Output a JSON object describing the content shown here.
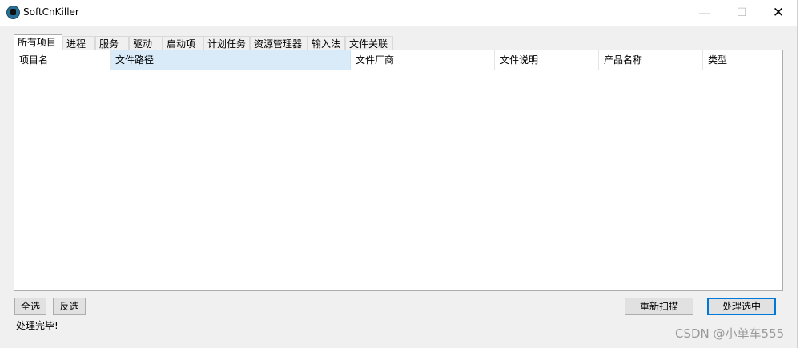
{
  "window": {
    "title": "SoftCnKiller"
  },
  "titlebar": {
    "minimize_glyph": "—",
    "maximize_glyph": "☐",
    "close_glyph": "✕"
  },
  "tabs": [
    "所有项目",
    "进程",
    "服务",
    "驱动",
    "启动项",
    "计划任务",
    "资源管理器",
    "输入法",
    "文件关联"
  ],
  "active_tab": "所有项目",
  "list": {
    "columns": [
      "项目名",
      "文件路径",
      "文件厂商",
      "文件说明",
      "产品名称",
      "类型"
    ],
    "rows": []
  },
  "buttons": {
    "select_all": "全选",
    "invert_select": "反选",
    "rescan": "重新扫描",
    "process_selected": "处理选中"
  },
  "status_text": "处理完毕!",
  "watermark": "CSDN @小单车555"
}
